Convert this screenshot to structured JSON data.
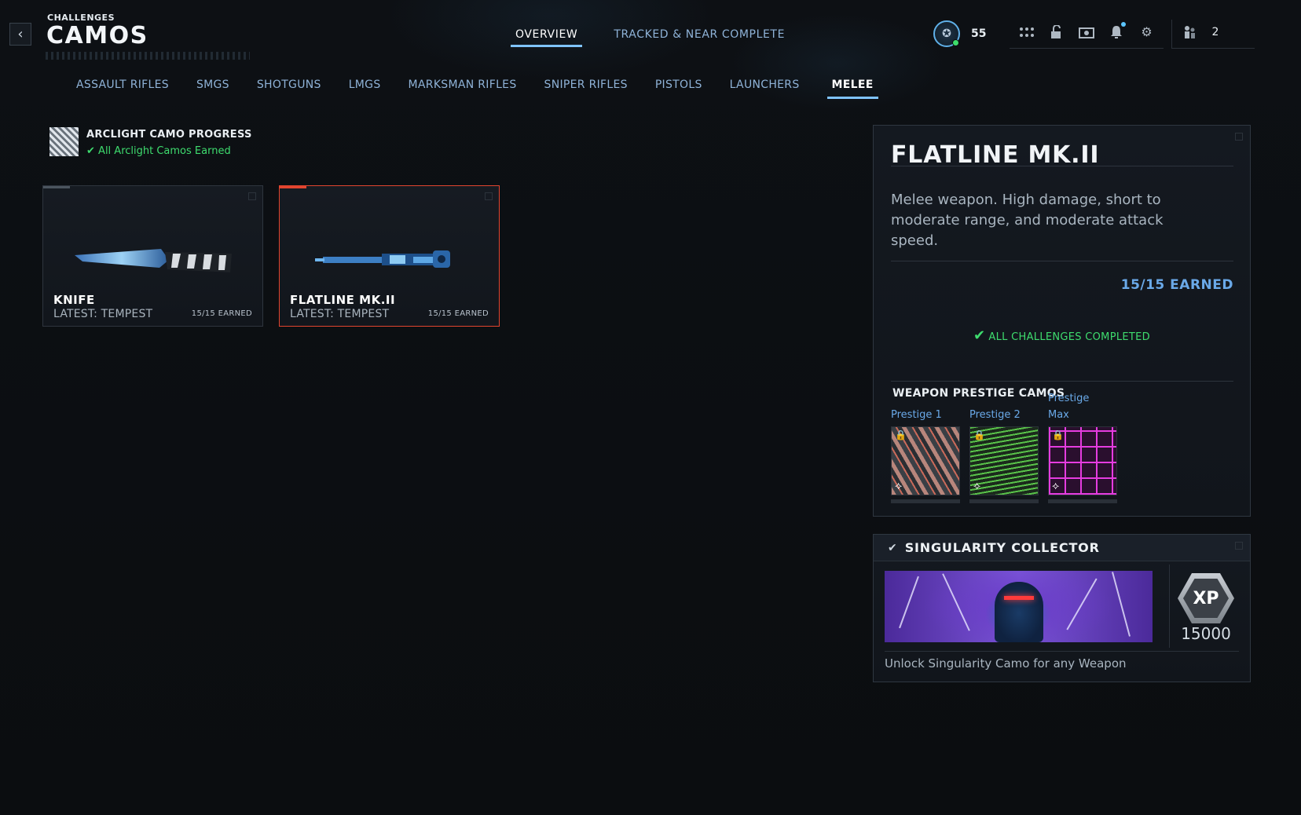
{
  "header": {
    "subtitle": "CHALLENGES",
    "title": "CAMOS",
    "tabs": [
      {
        "label": "OVERVIEW",
        "active": true
      },
      {
        "label": "TRACKED & NEAR COMPLETE",
        "active": false
      }
    ],
    "player_level": "55",
    "party_count": "2",
    "icons": [
      "level-badge-icon",
      "grid-menu-icon",
      "unlock-icon",
      "store-icon",
      "notification-bell-icon",
      "settings-gear-icon",
      "party-icon"
    ]
  },
  "categories": [
    {
      "label": "ASSAULT RIFLES",
      "active": false
    },
    {
      "label": "SMGS",
      "active": false
    },
    {
      "label": "SHOTGUNS",
      "active": false
    },
    {
      "label": "LMGS",
      "active": false
    },
    {
      "label": "MARKSMAN RIFLES",
      "active": false
    },
    {
      "label": "SNIPER RIFLES",
      "active": false
    },
    {
      "label": "PISTOLS",
      "active": false
    },
    {
      "label": "LAUNCHERS",
      "active": false
    },
    {
      "label": "MELEE",
      "active": true
    }
  ],
  "arclight": {
    "title": "ARCLIGHT CAMO PROGRESS",
    "status": "All Arclight Camos Earned"
  },
  "weapons": [
    {
      "name": "KNIFE",
      "latest": "LATEST: TEMPEST",
      "earned": "15/15 EARNED",
      "selected": false
    },
    {
      "name": "FLATLINE MK.II",
      "latest": "LATEST: TEMPEST",
      "earned": "15/15 EARNED",
      "selected": true
    }
  ],
  "details": {
    "title": "FLATLINE MK.II",
    "description": "Melee weapon. High damage, short to moderate range, and moderate attack speed.",
    "earned": "15/15 EARNED",
    "status": "ALL CHALLENGES COMPLETED",
    "prestige_title": "WEAPON PRESTIGE CAMOS",
    "prestige": [
      {
        "label": "Prestige 1",
        "locked": true
      },
      {
        "label": "Prestige 2",
        "locked": true
      },
      {
        "label": "Prestige Max",
        "locked": true
      }
    ]
  },
  "reward": {
    "title": "SINGULARITY COLLECTOR",
    "xp_label": "XP",
    "xp_amount": "15000",
    "description": "Unlock Singularity Camo for any Weapon"
  },
  "colors": {
    "accent_blue": "#7fc3ff",
    "earned_blue": "#6aa9e8",
    "success_green": "#3edc6e",
    "selected_red": "#e2452f"
  }
}
